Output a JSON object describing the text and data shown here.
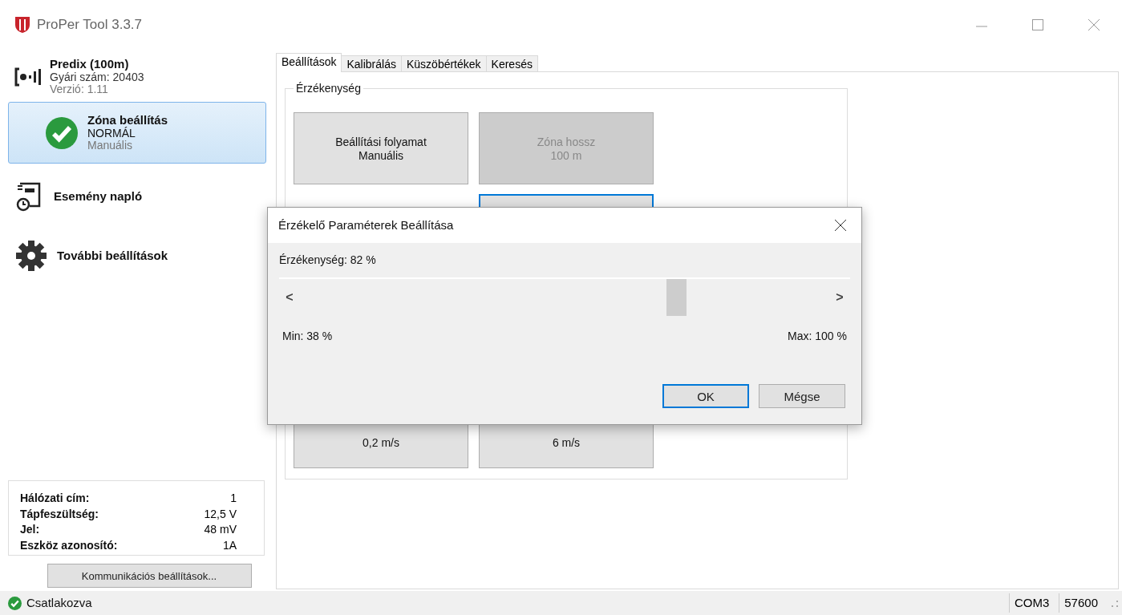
{
  "window": {
    "title": "ProPer Tool 3.3.7"
  },
  "device": {
    "name": "Predix (100m)",
    "serial": "Gyári szám: 20403",
    "version": "Verzió: 1.11"
  },
  "sidebar": {
    "items": [
      {
        "kind": "status",
        "title": "Zóna beállítás",
        "line1": "NORMÁL",
        "line2": "Manuális",
        "selected": true
      },
      {
        "kind": "log",
        "title": "Esemény napló",
        "selected": false
      },
      {
        "kind": "settings",
        "title": "További beállítások",
        "selected": false
      }
    ]
  },
  "info": [
    {
      "label": "Hálózati cím:",
      "value": "1"
    },
    {
      "label": "Tápfeszültség:",
      "value": "12,5 V"
    },
    {
      "label": "Jel:",
      "value": "48 mV"
    },
    {
      "label": "Eszköz azonosító:",
      "value": "1A"
    }
  ],
  "comm_button": "Kommunikációs beállítások...",
  "tabs": [
    {
      "label": "Beállítások",
      "selected": true
    },
    {
      "label": "Kalibrálás",
      "selected": false
    },
    {
      "label": "Küszöbértékek",
      "selected": false
    },
    {
      "label": "Keresés",
      "selected": false
    }
  ],
  "group": {
    "title": "Érzékenység",
    "buttons": [
      {
        "lines": [
          "Beállítási folyamat",
          "Manuális"
        ],
        "disabled": false,
        "focused": false
      },
      {
        "lines": [
          "Zóna hossz",
          "100 m"
        ],
        "disabled": true,
        "focused": false
      },
      {
        "disabled": false,
        "focused": true
      },
      {
        "lines": [
          "0,2 m/s"
        ],
        "disabled": false,
        "focused": false
      },
      {
        "lines": [
          "6 m/s"
        ],
        "disabled": false,
        "focused": false
      }
    ]
  },
  "dialog": {
    "title": "Érzékelő Paraméterek Beállítása",
    "value_label": "Érzékenység: 82 %",
    "slider": {
      "level": 0.71,
      "left": "<",
      "right": ">"
    },
    "min": "Min: 38 %",
    "max": "Max: 100 %",
    "buttons": [
      {
        "label": "OK",
        "default": true
      },
      {
        "label": "Mégse",
        "default": false
      }
    ]
  },
  "status_bar": {
    "connection": "Csatlakozva",
    "port": "COM3",
    "baud": "57600"
  }
}
